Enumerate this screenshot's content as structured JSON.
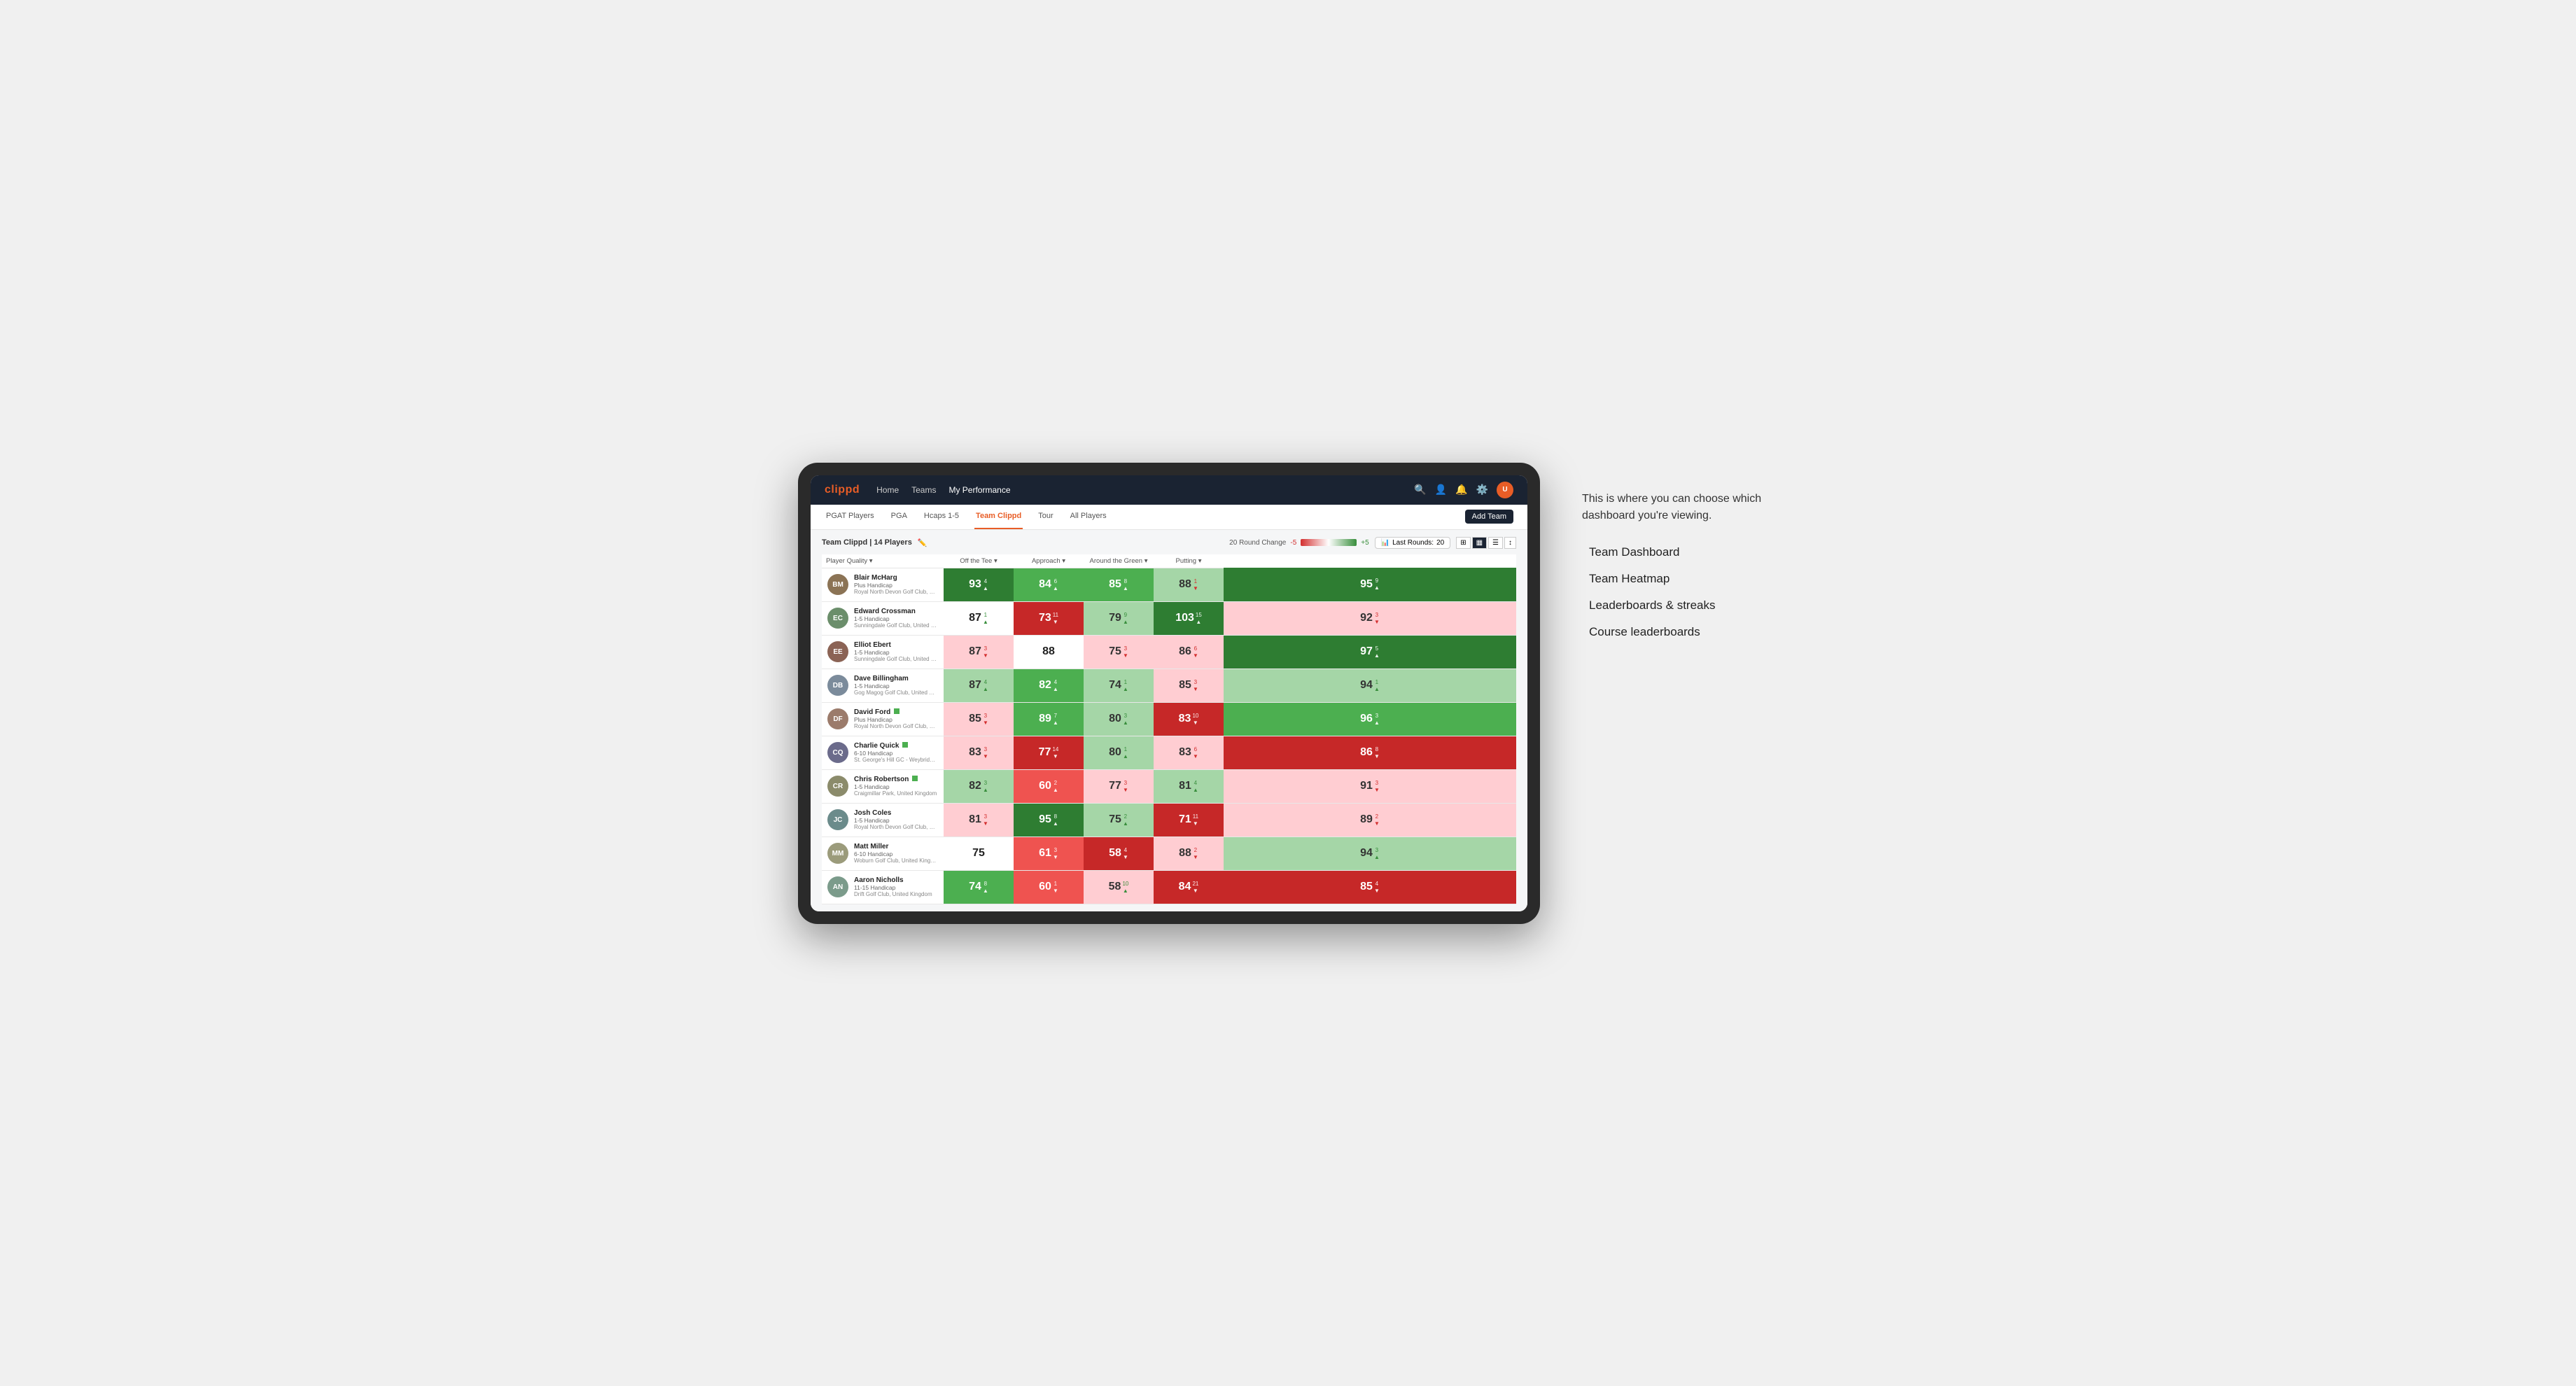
{
  "annotation": {
    "intro": "This is where you can choose which dashboard you're viewing.",
    "items": [
      {
        "label": "Team Dashboard"
      },
      {
        "label": "Team Heatmap"
      },
      {
        "label": "Leaderboards & streaks"
      },
      {
        "label": "Course leaderboards"
      }
    ]
  },
  "navbar": {
    "logo": "clippd",
    "links": [
      {
        "label": "Home",
        "active": false
      },
      {
        "label": "Teams",
        "active": false
      },
      {
        "label": "My Performance",
        "active": true
      }
    ],
    "icons": [
      "search",
      "user",
      "bell",
      "settings",
      "avatar"
    ]
  },
  "subnav": {
    "links": [
      {
        "label": "PGAT Players",
        "active": false
      },
      {
        "label": "PGA",
        "active": false
      },
      {
        "label": "Hcaps 1-5",
        "active": false
      },
      {
        "label": "Team Clippd",
        "active": true
      },
      {
        "label": "Tour",
        "active": false
      },
      {
        "label": "All Players",
        "active": false
      }
    ],
    "add_team_label": "Add Team"
  },
  "team_header": {
    "title": "Team Clippd | 14 Players",
    "round_change_label": "20 Round Change",
    "range_min": "-5",
    "range_max": "+5",
    "last_rounds_label": "Last Rounds:",
    "last_rounds_value": "20"
  },
  "table": {
    "columns": [
      {
        "label": "Player Quality ▾",
        "key": "player_quality"
      },
      {
        "label": "Off the Tee ▾",
        "key": "off_tee"
      },
      {
        "label": "Approach ▾",
        "key": "approach"
      },
      {
        "label": "Around the Green ▾",
        "key": "around_green"
      },
      {
        "label": "Putting ▾",
        "key": "putting"
      }
    ],
    "rows": [
      {
        "name": "Blair McHarg",
        "hcap": "Plus Handicap",
        "club": "Royal North Devon Golf Club, United Kingdom",
        "initials": "BM",
        "avatar_color": "#8B7355",
        "player_quality": {
          "val": 93,
          "change": 4,
          "dir": "up",
          "bg": "green-dark"
        },
        "off_tee": {
          "val": 84,
          "change": 6,
          "dir": "up",
          "bg": "green-med"
        },
        "approach": {
          "val": 85,
          "change": 8,
          "dir": "up",
          "bg": "green-med"
        },
        "around_green": {
          "val": 88,
          "change": 1,
          "dir": "down",
          "bg": "green-light"
        },
        "putting": {
          "val": 95,
          "change": 9,
          "dir": "up",
          "bg": "green-dark"
        }
      },
      {
        "name": "Edward Crossman",
        "hcap": "1-5 Handicap",
        "club": "Sunningdale Golf Club, United Kingdom",
        "initials": "EC",
        "avatar_color": "#6B8E6B",
        "player_quality": {
          "val": 87,
          "change": 1,
          "dir": "up",
          "bg": "white"
        },
        "off_tee": {
          "val": 73,
          "change": 11,
          "dir": "down",
          "bg": "red-dark"
        },
        "approach": {
          "val": 79,
          "change": 9,
          "dir": "up",
          "bg": "green-light"
        },
        "around_green": {
          "val": 103,
          "change": 15,
          "dir": "up",
          "bg": "green-dark"
        },
        "putting": {
          "val": 92,
          "change": 3,
          "dir": "down",
          "bg": "red-light"
        }
      },
      {
        "name": "Elliot Ebert",
        "hcap": "1-5 Handicap",
        "club": "Sunningdale Golf Club, United Kingdom",
        "initials": "EE",
        "avatar_color": "#8B6355",
        "player_quality": {
          "val": 87,
          "change": 3,
          "dir": "down",
          "bg": "red-light"
        },
        "off_tee": {
          "val": 88,
          "change": 0,
          "dir": "none",
          "bg": "white"
        },
        "approach": {
          "val": 75,
          "change": 3,
          "dir": "down",
          "bg": "red-light"
        },
        "around_green": {
          "val": 86,
          "change": 6,
          "dir": "down",
          "bg": "red-light"
        },
        "putting": {
          "val": 97,
          "change": 5,
          "dir": "up",
          "bg": "green-dark"
        }
      },
      {
        "name": "Dave Billingham",
        "hcap": "1-5 Handicap",
        "club": "Gog Magog Golf Club, United Kingdom",
        "initials": "DB",
        "avatar_color": "#7B8B9B",
        "player_quality": {
          "val": 87,
          "change": 4,
          "dir": "up",
          "bg": "green-light"
        },
        "off_tee": {
          "val": 82,
          "change": 4,
          "dir": "up",
          "bg": "green-med"
        },
        "approach": {
          "val": 74,
          "change": 1,
          "dir": "up",
          "bg": "green-light"
        },
        "around_green": {
          "val": 85,
          "change": 3,
          "dir": "down",
          "bg": "red-light"
        },
        "putting": {
          "val": 94,
          "change": 1,
          "dir": "up",
          "bg": "green-light"
        }
      },
      {
        "name": "David Ford",
        "hcap": "Plus Handicap",
        "club": "Royal North Devon Golf Club, United Kingdom",
        "initials": "DF",
        "avatar_color": "#9B7B6B",
        "verified": true,
        "player_quality": {
          "val": 85,
          "change": 3,
          "dir": "down",
          "bg": "red-light"
        },
        "off_tee": {
          "val": 89,
          "change": 7,
          "dir": "up",
          "bg": "green-med"
        },
        "approach": {
          "val": 80,
          "change": 3,
          "dir": "up",
          "bg": "green-light"
        },
        "around_green": {
          "val": 83,
          "change": 10,
          "dir": "down",
          "bg": "red-dark"
        },
        "putting": {
          "val": 96,
          "change": 3,
          "dir": "up",
          "bg": "green-med"
        }
      },
      {
        "name": "Charlie Quick",
        "hcap": "6-10 Handicap",
        "club": "St. George's Hill GC - Weybridge, Surrey, Uni...",
        "initials": "CQ",
        "avatar_color": "#6B6B8B",
        "verified": true,
        "player_quality": {
          "val": 83,
          "change": 3,
          "dir": "down",
          "bg": "red-light"
        },
        "off_tee": {
          "val": 77,
          "change": 14,
          "dir": "down",
          "bg": "red-dark"
        },
        "approach": {
          "val": 80,
          "change": 1,
          "dir": "up",
          "bg": "green-light"
        },
        "around_green": {
          "val": 83,
          "change": 6,
          "dir": "down",
          "bg": "red-light"
        },
        "putting": {
          "val": 86,
          "change": 8,
          "dir": "down",
          "bg": "red-dark"
        }
      },
      {
        "name": "Chris Robertson",
        "hcap": "1-5 Handicap",
        "club": "Craigmillar Park, United Kingdom",
        "initials": "CR",
        "avatar_color": "#8B8B6B",
        "verified": true,
        "player_quality": {
          "val": 82,
          "change": 3,
          "dir": "up",
          "bg": "green-light"
        },
        "off_tee": {
          "val": 60,
          "change": 2,
          "dir": "up",
          "bg": "red-med"
        },
        "approach": {
          "val": 77,
          "change": 3,
          "dir": "down",
          "bg": "red-light"
        },
        "around_green": {
          "val": 81,
          "change": 4,
          "dir": "up",
          "bg": "green-light"
        },
        "putting": {
          "val": 91,
          "change": 3,
          "dir": "down",
          "bg": "red-light"
        }
      },
      {
        "name": "Josh Coles",
        "hcap": "1-5 Handicap",
        "club": "Royal North Devon Golf Club, United Kingdom",
        "initials": "JC",
        "avatar_color": "#6B8B8B",
        "player_quality": {
          "val": 81,
          "change": 3,
          "dir": "down",
          "bg": "red-light"
        },
        "off_tee": {
          "val": 95,
          "change": 8,
          "dir": "up",
          "bg": "green-dark"
        },
        "approach": {
          "val": 75,
          "change": 2,
          "dir": "up",
          "bg": "green-light"
        },
        "around_green": {
          "val": 71,
          "change": 11,
          "dir": "down",
          "bg": "red-dark"
        },
        "putting": {
          "val": 89,
          "change": 2,
          "dir": "down",
          "bg": "red-light"
        }
      },
      {
        "name": "Matt Miller",
        "hcap": "6-10 Handicap",
        "club": "Woburn Golf Club, United Kingdom",
        "initials": "MM",
        "avatar_color": "#9B9B7B",
        "player_quality": {
          "val": 75,
          "change": 0,
          "dir": "none",
          "bg": "white"
        },
        "off_tee": {
          "val": 61,
          "change": 3,
          "dir": "down",
          "bg": "red-med"
        },
        "approach": {
          "val": 58,
          "change": 4,
          "dir": "down",
          "bg": "red-dark"
        },
        "around_green": {
          "val": 88,
          "change": 2,
          "dir": "down",
          "bg": "red-light"
        },
        "putting": {
          "val": 94,
          "change": 3,
          "dir": "up",
          "bg": "green-light"
        }
      },
      {
        "name": "Aaron Nicholls",
        "hcap": "11-15 Handicap",
        "club": "Drift Golf Club, United Kingdom",
        "initials": "AN",
        "avatar_color": "#7B9B8B",
        "player_quality": {
          "val": 74,
          "change": 8,
          "dir": "up",
          "bg": "green-med"
        },
        "off_tee": {
          "val": 60,
          "change": 1,
          "dir": "down",
          "bg": "red-med"
        },
        "approach": {
          "val": 58,
          "change": 10,
          "dir": "up",
          "bg": "red-light"
        },
        "around_green": {
          "val": 84,
          "change": 21,
          "dir": "down",
          "bg": "red-dark"
        },
        "putting": {
          "val": 85,
          "change": 4,
          "dir": "down",
          "bg": "red-dark"
        }
      }
    ]
  }
}
